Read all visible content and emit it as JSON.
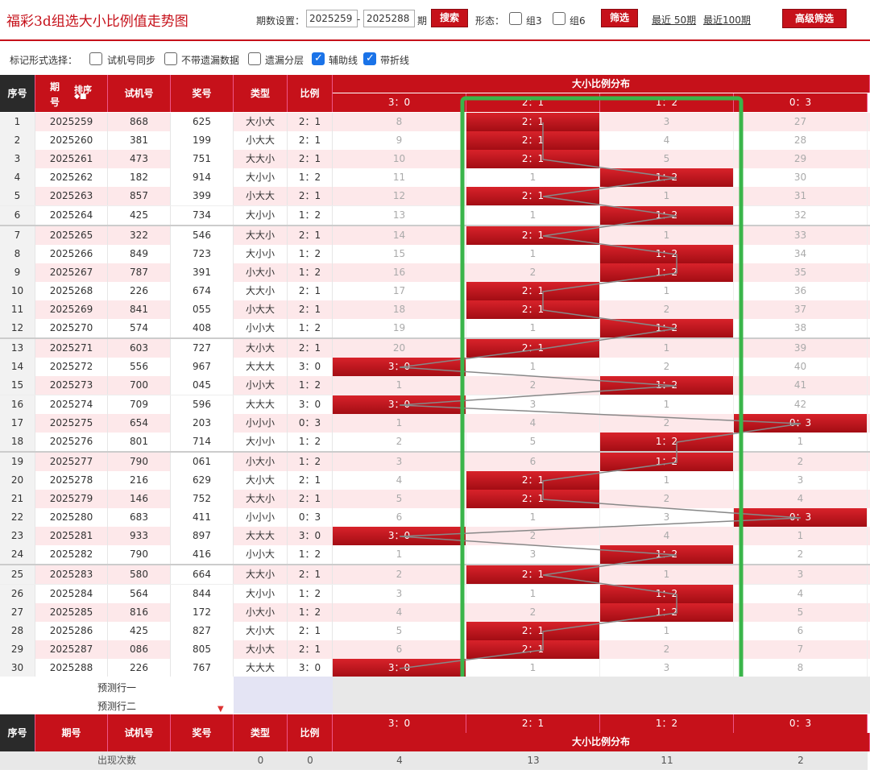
{
  "page": {
    "title": "福彩3d组选大小比例值走势图",
    "period_label": "期数设置：",
    "period_start": "2025259",
    "period_dash": "-",
    "period_end": "2025288",
    "period_unit": "期",
    "search_btn": "搜索",
    "form_label": "形态：",
    "group3": "组3",
    "group6": "组6",
    "filter_btn": "筛选",
    "recent50": "最近 50期",
    "recent100": "最近100期",
    "advanced_btn": "高级筛选"
  },
  "options": {
    "label": "标记形式选择：",
    "items": [
      {
        "label": "试机号同步",
        "checked": false
      },
      {
        "label": "不带遗漏数据",
        "checked": false
      },
      {
        "label": "遗漏分层",
        "checked": false
      },
      {
        "label": "辅助线",
        "checked": true
      },
      {
        "label": "带折线",
        "checked": true
      }
    ]
  },
  "headers": {
    "seq": "序号",
    "issue_a": "期",
    "issue_b": "号",
    "sort": "排序",
    "trial": "试机号",
    "prize": "奖号",
    "type": "类型",
    "ratio": "比例",
    "dist": "大小比例分布",
    "dist_cols": [
      "3：0",
      "2：1",
      "1：2",
      "0：3"
    ],
    "issue_full": "期号"
  },
  "rows": [
    {
      "seq": "1",
      "issue": "2025259",
      "trial": "868",
      "prize": "625",
      "type": "大小大",
      "ratio": "2：1",
      "d": [
        "8",
        "2：1",
        "3",
        "27"
      ],
      "hit": 1
    },
    {
      "seq": "2",
      "issue": "2025260",
      "trial": "381",
      "prize": "199",
      "type": "小大大",
      "ratio": "2：1",
      "d": [
        "9",
        "2：1",
        "4",
        "28"
      ],
      "hit": 1
    },
    {
      "seq": "3",
      "issue": "2025261",
      "trial": "473",
      "prize": "751",
      "type": "大大小",
      "ratio": "2：1",
      "d": [
        "10",
        "2：1",
        "5",
        "29"
      ],
      "hit": 1
    },
    {
      "seq": "4",
      "issue": "2025262",
      "trial": "182",
      "prize": "914",
      "type": "大小小",
      "ratio": "1：2",
      "d": [
        "11",
        "1",
        "1：2",
        "30"
      ],
      "hit": 2
    },
    {
      "seq": "5",
      "issue": "2025263",
      "trial": "857",
      "prize": "399",
      "type": "小大大",
      "ratio": "2：1",
      "d": [
        "12",
        "2：1",
        "1",
        "31"
      ],
      "hit": 1
    },
    {
      "seq": "6",
      "issue": "2025264",
      "trial": "425",
      "prize": "734",
      "type": "大小小",
      "ratio": "1：2",
      "d": [
        "13",
        "1",
        "1：2",
        "32"
      ],
      "hit": 2
    },
    {
      "seq": "7",
      "issue": "2025265",
      "trial": "322",
      "prize": "546",
      "type": "大大小",
      "ratio": "2：1",
      "d": [
        "14",
        "2：1",
        "1",
        "33"
      ],
      "hit": 1
    },
    {
      "seq": "8",
      "issue": "2025266",
      "trial": "849",
      "prize": "723",
      "type": "大小小",
      "ratio": "1：2",
      "d": [
        "15",
        "1",
        "1：2",
        "34"
      ],
      "hit": 2
    },
    {
      "seq": "9",
      "issue": "2025267",
      "trial": "787",
      "prize": "391",
      "type": "小大小",
      "ratio": "1：2",
      "d": [
        "16",
        "2",
        "1：2",
        "35"
      ],
      "hit": 2
    },
    {
      "seq": "10",
      "issue": "2025268",
      "trial": "226",
      "prize": "674",
      "type": "大大小",
      "ratio": "2：1",
      "d": [
        "17",
        "2：1",
        "1",
        "36"
      ],
      "hit": 1
    },
    {
      "seq": "11",
      "issue": "2025269",
      "trial": "841",
      "prize": "055",
      "type": "小大大",
      "ratio": "2：1",
      "d": [
        "18",
        "2：1",
        "2",
        "37"
      ],
      "hit": 1
    },
    {
      "seq": "12",
      "issue": "2025270",
      "trial": "574",
      "prize": "408",
      "type": "小小大",
      "ratio": "1：2",
      "d": [
        "19",
        "1",
        "1：2",
        "38"
      ],
      "hit": 2
    },
    {
      "seq": "13",
      "issue": "2025271",
      "trial": "603",
      "prize": "727",
      "type": "大小大",
      "ratio": "2：1",
      "d": [
        "20",
        "2：1",
        "1",
        "39"
      ],
      "hit": 1
    },
    {
      "seq": "14",
      "issue": "2025272",
      "trial": "556",
      "prize": "967",
      "type": "大大大",
      "ratio": "3：0",
      "d": [
        "3：0",
        "1",
        "2",
        "40"
      ],
      "hit": 0
    },
    {
      "seq": "15",
      "issue": "2025273",
      "trial": "700",
      "prize": "045",
      "type": "小小大",
      "ratio": "1：2",
      "d": [
        "1",
        "2",
        "1：2",
        "41"
      ],
      "hit": 2
    },
    {
      "seq": "16",
      "issue": "2025274",
      "trial": "709",
      "prize": "596",
      "type": "大大大",
      "ratio": "3：0",
      "d": [
        "3：0",
        "3",
        "1",
        "42"
      ],
      "hit": 0
    },
    {
      "seq": "17",
      "issue": "2025275",
      "trial": "654",
      "prize": "203",
      "type": "小小小",
      "ratio": "0：3",
      "d": [
        "1",
        "4",
        "2",
        "0：3"
      ],
      "hit": 3
    },
    {
      "seq": "18",
      "issue": "2025276",
      "trial": "801",
      "prize": "714",
      "type": "大小小",
      "ratio": "1：2",
      "d": [
        "2",
        "5",
        "1：2",
        "1"
      ],
      "hit": 2
    },
    {
      "seq": "19",
      "issue": "2025277",
      "trial": "790",
      "prize": "061",
      "type": "小大小",
      "ratio": "1：2",
      "d": [
        "3",
        "6",
        "1：2",
        "2"
      ],
      "hit": 2
    },
    {
      "seq": "20",
      "issue": "2025278",
      "trial": "216",
      "prize": "629",
      "type": "大小大",
      "ratio": "2：1",
      "d": [
        "4",
        "2：1",
        "1",
        "3"
      ],
      "hit": 1
    },
    {
      "seq": "21",
      "issue": "2025279",
      "trial": "146",
      "prize": "752",
      "type": "大大小",
      "ratio": "2：1",
      "d": [
        "5",
        "2：1",
        "2",
        "4"
      ],
      "hit": 1
    },
    {
      "seq": "22",
      "issue": "2025280",
      "trial": "683",
      "prize": "411",
      "type": "小小小",
      "ratio": "0：3",
      "d": [
        "6",
        "1",
        "3",
        "0：3"
      ],
      "hit": 3
    },
    {
      "seq": "23",
      "issue": "2025281",
      "trial": "933",
      "prize": "897",
      "type": "大大大",
      "ratio": "3：0",
      "d": [
        "3：0",
        "2",
        "4",
        "1"
      ],
      "hit": 0
    },
    {
      "seq": "24",
      "issue": "2025282",
      "trial": "790",
      "prize": "416",
      "type": "小小大",
      "ratio": "1：2",
      "d": [
        "1",
        "3",
        "1：2",
        "2"
      ],
      "hit": 2
    },
    {
      "seq": "25",
      "issue": "2025283",
      "trial": "580",
      "prize": "664",
      "type": "大大小",
      "ratio": "2：1",
      "d": [
        "2",
        "2：1",
        "1",
        "3"
      ],
      "hit": 1
    },
    {
      "seq": "26",
      "issue": "2025284",
      "trial": "564",
      "prize": "844",
      "type": "大小小",
      "ratio": "1：2",
      "d": [
        "3",
        "1",
        "1：2",
        "4"
      ],
      "hit": 2
    },
    {
      "seq": "27",
      "issue": "2025285",
      "trial": "816",
      "prize": "172",
      "type": "小大小",
      "ratio": "1：2",
      "d": [
        "4",
        "2",
        "1：2",
        "5"
      ],
      "hit": 2
    },
    {
      "seq": "28",
      "issue": "2025286",
      "trial": "425",
      "prize": "827",
      "type": "大小大",
      "ratio": "2：1",
      "d": [
        "5",
        "2：1",
        "1",
        "6"
      ],
      "hit": 1
    },
    {
      "seq": "29",
      "issue": "2025287",
      "trial": "086",
      "prize": "805",
      "type": "大小大",
      "ratio": "2：1",
      "d": [
        "6",
        "2：1",
        "2",
        "7"
      ],
      "hit": 1
    },
    {
      "seq": "30",
      "issue": "2025288",
      "trial": "226",
      "prize": "767",
      "type": "大大大",
      "ratio": "3：0",
      "d": [
        "3：0",
        "1",
        "3",
        "8"
      ],
      "hit": 0
    }
  ],
  "predict": {
    "row1": "预测行一",
    "row2": "预测行二"
  },
  "footer": {
    "label": "出现次数",
    "type": "0",
    "ratio": "0",
    "counts": [
      "4",
      "13",
      "11",
      "2"
    ]
  },
  "colors": {
    "accent": "#c6111a",
    "highlight": "#3ab54a"
  }
}
